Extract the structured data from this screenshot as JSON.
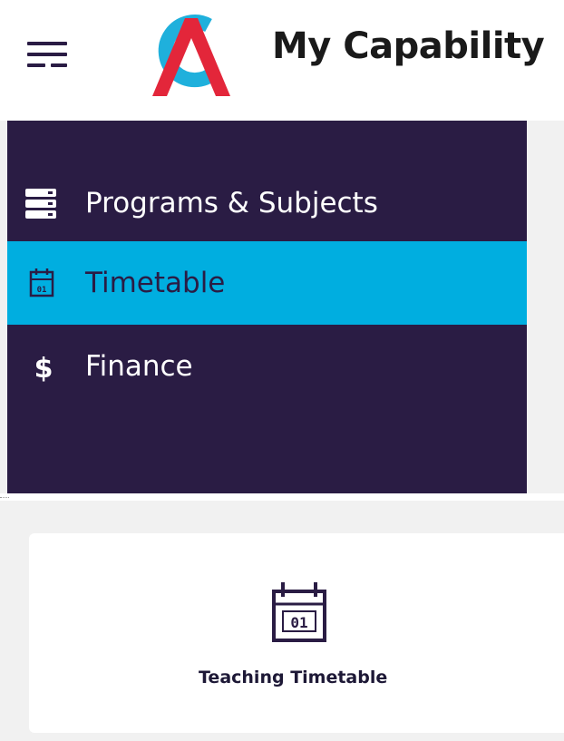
{
  "header": {
    "app_title": "My Capability",
    "menu_icon": "hamburger-menu-icon",
    "logo_icon": "capability-logo",
    "logo_colors": {
      "red": "#e3263a",
      "blue": "#1fb0dc"
    }
  },
  "sidebar": {
    "background": "#2a1c44",
    "active_color": "#00aee0",
    "items": [
      {
        "label": "Programs & Subjects",
        "icon": "server-stack-icon",
        "active": false
      },
      {
        "label": "Timetable",
        "icon": "calendar-icon",
        "active": true
      },
      {
        "label": "Finance",
        "icon": "dollar-icon",
        "active": false
      }
    ]
  },
  "main": {
    "cards": [
      {
        "label": "Teaching Timetable",
        "icon": "calendar-icon",
        "icon_text": "01"
      }
    ]
  }
}
